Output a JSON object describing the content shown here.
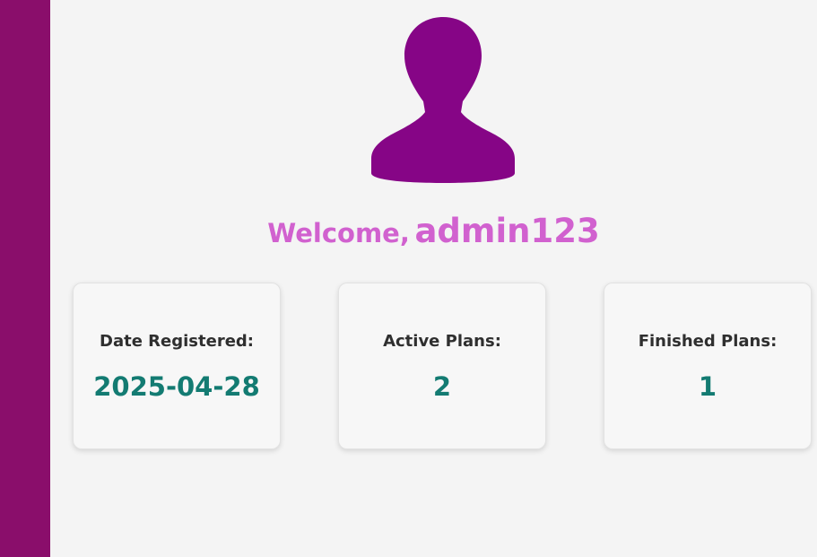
{
  "colors": {
    "sidebar": "#8a0e6b",
    "avatar": "#860586",
    "welcome": "#d161cf",
    "stat_value": "#137b72",
    "stat_label": "#2f2f2f",
    "background": "#f4f4f4"
  },
  "avatar": {
    "icon": "user-silhouette-icon"
  },
  "welcome": {
    "label": "Welcome,",
    "username": "admin123"
  },
  "stats": [
    {
      "label": "Date Registered:",
      "value": "2025-04-28"
    },
    {
      "label": "Active Plans:",
      "value": "2"
    },
    {
      "label": "Finished Plans:",
      "value": "1"
    }
  ]
}
